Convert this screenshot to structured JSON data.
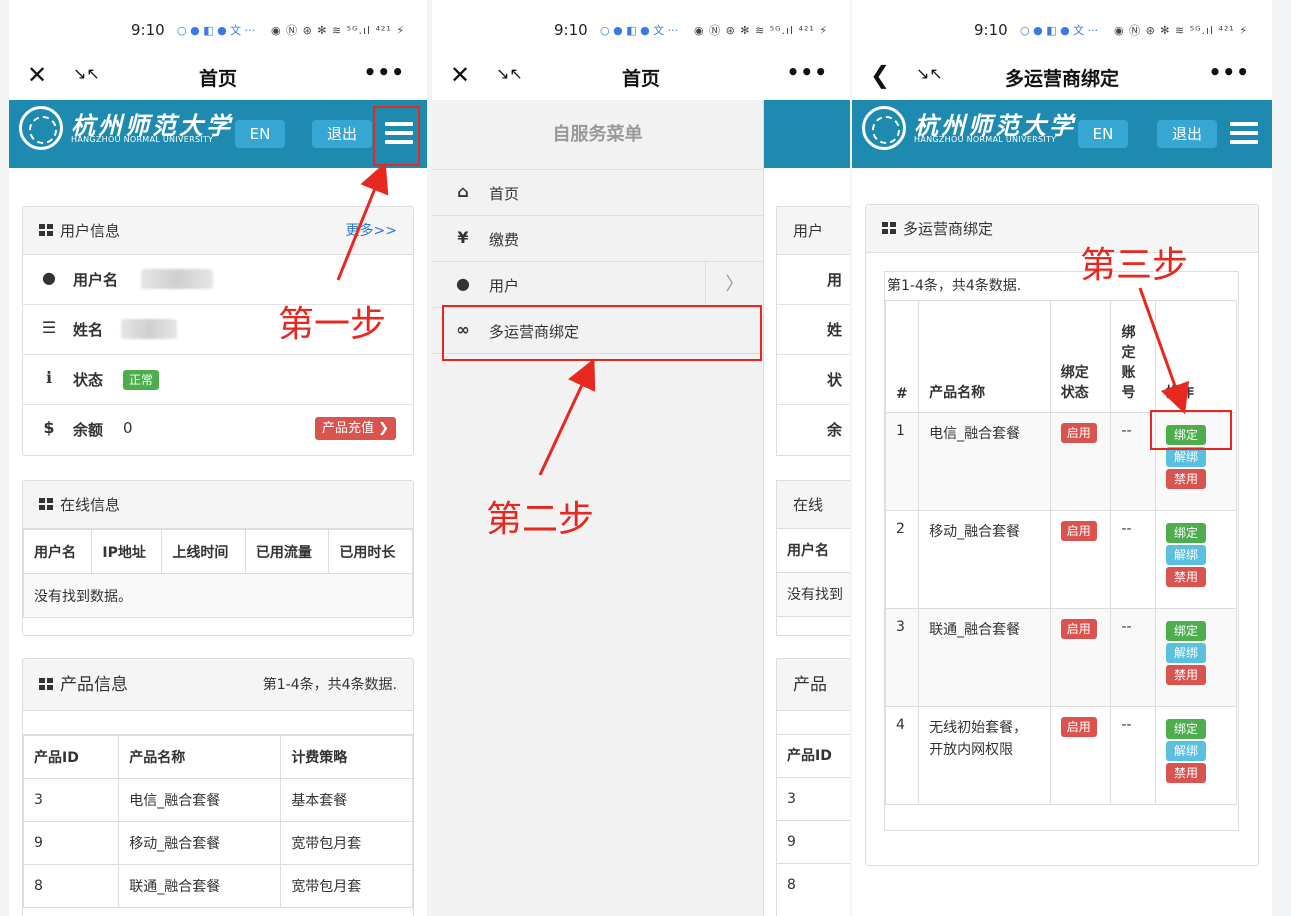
{
  "status": {
    "time": "9:10",
    "icons": "◉ Ⓝ ⊛ ✻ ≋ ⁵ᴳ.ıl ⁴²¹ ⚡",
    "notif": "○ ● ◧ ● 文 ···"
  },
  "p1": {
    "title": "首页",
    "logo_cn": "杭州师范大学",
    "logo_en": "HANGZHOU NORMAL UNIVERSITY",
    "en_btn": "EN",
    "logout_btn": "退出",
    "user_panel": {
      "title": "用户信息",
      "more": "更多>>",
      "rows": [
        {
          "icon": "user-icon",
          "label": "用户名",
          "glyph": "●"
        },
        {
          "icon": "list-icon",
          "label": "姓名",
          "glyph": "☰"
        },
        {
          "icon": "info-icon",
          "label": "状态",
          "glyph": "ℹ",
          "badge": "正常"
        },
        {
          "icon": "dollar-icon",
          "label": "余额",
          "glyph": "$",
          "value": "0",
          "button": "产品充值 ❯"
        }
      ]
    },
    "online_panel": {
      "title": "在线信息",
      "headers": [
        "用户名",
        "IP地址",
        "上线时间",
        "已用流量",
        "已用时长"
      ],
      "empty": "没有找到数据。"
    },
    "product_panel": {
      "title": "产品信息",
      "summary": "第1-4条，共4条数据.",
      "headers": [
        "产品ID",
        "产品名称",
        "计费策略"
      ],
      "rows": [
        [
          "3",
          "电信_融合套餐",
          "基本套餐"
        ],
        [
          "9",
          "移动_融合套餐",
          "宽带包月套"
        ],
        [
          "8",
          "联通_融合套餐",
          "宽带包月套"
        ]
      ]
    }
  },
  "p2": {
    "title": "首页",
    "drawer_title": "自服务菜单",
    "menu": [
      {
        "icon": "home-icon",
        "glyph": "⌂",
        "label": "首页"
      },
      {
        "icon": "yen-icon",
        "glyph": "¥",
        "label": "缴费"
      },
      {
        "icon": "user-icon",
        "glyph": "●",
        "label": "用户",
        "chevron": "〉"
      },
      {
        "icon": "link-icon",
        "glyph": "∞",
        "label": "多运营商绑定"
      }
    ],
    "peek": {
      "rows": [
        "用户",
        "用",
        "姓",
        "状",
        "余",
        "在线",
        "用户名",
        "没有找到",
        "产品",
        "产品ID",
        "3",
        "9",
        "8"
      ]
    }
  },
  "p3": {
    "title": "多运营商绑定",
    "panel_title": "多运营商绑定",
    "summary": "第1-4条，共4条数据.",
    "headers": [
      "#",
      "产品名称",
      "绑定状态",
      "绑定账号",
      "操作"
    ],
    "rows": [
      {
        "n": "1",
        "name": "电信_融合套餐",
        "status": "启用",
        "account": "--"
      },
      {
        "n": "2",
        "name": "移动_融合套餐",
        "status": "启用",
        "account": "--"
      },
      {
        "n": "3",
        "name": "联通_融合套餐",
        "status": "启用",
        "account": "--"
      },
      {
        "n": "4",
        "name": "无线初始套餐，开放内网权限",
        "status": "启用",
        "account": "--"
      }
    ],
    "actions": [
      "绑定",
      "解绑",
      "禁用"
    ]
  },
  "annotations": {
    "step1": "第一步",
    "step2": "第二步",
    "step3": "第三步"
  },
  "colors": {
    "header": "#1e8ab0",
    "annotation": "#e8271f",
    "green": "#4cae4c",
    "red": "#d9534f",
    "blue": "#5bc0de"
  }
}
